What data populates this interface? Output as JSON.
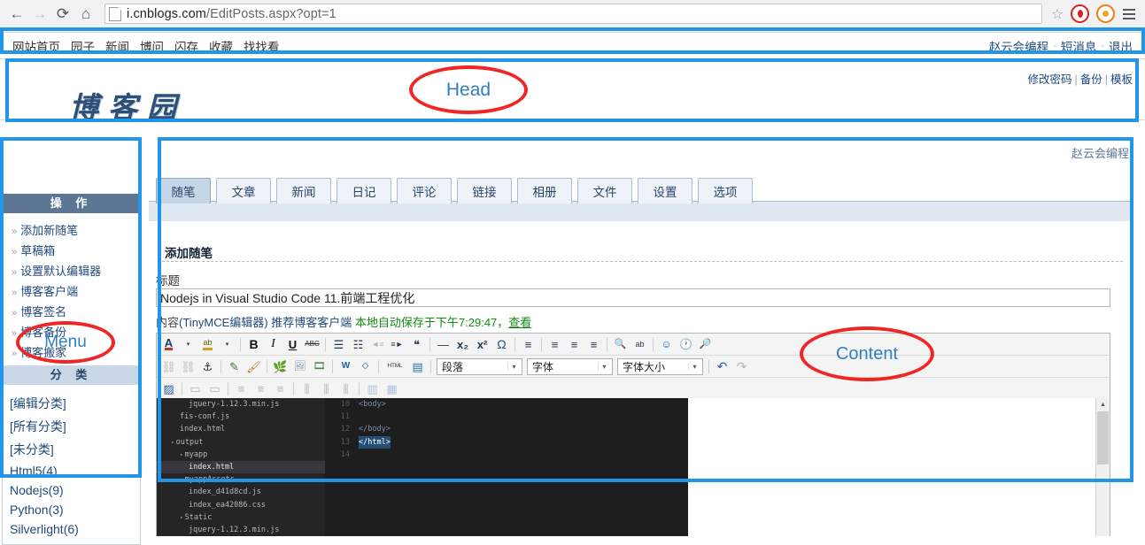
{
  "browser": {
    "back_icon": "←",
    "forward_icon": "→",
    "reload_icon": "⟳",
    "home_icon": "⌂",
    "url_prefix": "i.cnblogs.com",
    "url_path": "/EditPosts.aspx?opt=1",
    "star_icon": "☆",
    "page_icon": "page-icon",
    "extension_1": "opera-icon",
    "extension_2": "orange-circle-icon",
    "menu_icon": "hamburger-menu-icon"
  },
  "topnav": {
    "links": [
      "网站首页",
      "园子",
      "新闻",
      "博问",
      "闪存",
      "收藏",
      "找找看"
    ],
    "user": "赵云会编程",
    "messages": "短消息",
    "logout": "退出",
    "separator": "·"
  },
  "header": {
    "logo": "博客园",
    "links": [
      "修改密码",
      "备份",
      "模板"
    ],
    "divider": "|",
    "username": "赵云会编程"
  },
  "sidebar": {
    "operations_title": "操 作",
    "operations": [
      "添加新随笔",
      "草稿箱",
      "设置默认编辑器",
      "博客客户端",
      "博客签名",
      "博客备份",
      "博客搬家"
    ],
    "arrow": "»",
    "categories_title": "分 类",
    "categories": [
      "[编辑分类]",
      "[所有分类]",
      "[未分类]",
      "Html5(4)",
      "Nodejs(9)",
      "Python(3)",
      "Silverlight(6)"
    ]
  },
  "main": {
    "tabs": [
      {
        "label": "随笔",
        "active": true
      },
      {
        "label": "文章",
        "active": false
      },
      {
        "label": "新闻",
        "active": false
      },
      {
        "label": "日记",
        "active": false
      },
      {
        "label": "评论",
        "active": false
      },
      {
        "label": "链接",
        "active": false
      },
      {
        "label": "相册",
        "active": false
      },
      {
        "label": "文件",
        "active": false
      },
      {
        "label": "设置",
        "active": false
      },
      {
        "label": "选项",
        "active": false
      }
    ],
    "section_title": "添加随笔",
    "title_label": "标题",
    "title_value": "Nodejs in Visual Studio Code 11.前端工程优化",
    "meta": {
      "content_label": "内容",
      "editor_name": "(TinyMCE编辑器)",
      "client_tip": "推荐博客客户端",
      "autosave": "本地自动保存于下午7:29:47，",
      "view_link": "查看"
    }
  },
  "editor_toolbar": {
    "row1": [
      {
        "name": "text-color-icon",
        "glyph": "A"
      },
      {
        "name": "text-color-dropdown-icon",
        "glyph": "▾"
      },
      {
        "name": "background-color-icon",
        "glyph": "ab"
      },
      {
        "name": "background-color-dropdown-icon",
        "glyph": "▾"
      },
      {
        "name": "bold-icon",
        "glyph": "B"
      },
      {
        "name": "italic-icon",
        "glyph": "I"
      },
      {
        "name": "underline-icon",
        "glyph": "U"
      },
      {
        "name": "strikethrough-icon",
        "glyph": "ABC"
      },
      {
        "name": "bullet-list-icon",
        "glyph": "☰"
      },
      {
        "name": "numbered-list-icon",
        "glyph": "☷"
      },
      {
        "name": "outdent-icon",
        "glyph": "◄≡"
      },
      {
        "name": "indent-icon",
        "glyph": "≡►"
      },
      {
        "name": "blockquote-icon",
        "glyph": "❝"
      },
      {
        "name": "horizontal-rule-icon",
        "glyph": "—"
      },
      {
        "name": "subscript-icon",
        "glyph": "x₂"
      },
      {
        "name": "superscript-icon",
        "glyph": "x²"
      },
      {
        "name": "special-char-icon",
        "glyph": "Ω"
      },
      {
        "name": "align-left-icon",
        "glyph": "≡"
      },
      {
        "name": "align-center-icon",
        "glyph": "≡"
      },
      {
        "name": "align-right-icon",
        "glyph": "≡"
      },
      {
        "name": "find-icon",
        "glyph": "🔍"
      },
      {
        "name": "replace-icon",
        "glyph": "ab"
      },
      {
        "name": "emoticon-icon",
        "glyph": "☺"
      },
      {
        "name": "insert-date-icon",
        "glyph": "🕐"
      },
      {
        "name": "preview-icon",
        "glyph": "🔎"
      }
    ],
    "row2": [
      {
        "name": "unlink-icon",
        "glyph": "⛓"
      },
      {
        "name": "link-icon",
        "glyph": "⛓"
      },
      {
        "name": "anchor-icon",
        "glyph": "⚓"
      },
      {
        "name": "cleanup-icon",
        "glyph": "✎"
      },
      {
        "name": "remove-format-icon",
        "glyph": "🖌"
      },
      {
        "name": "insert-media-icon",
        "glyph": "🌿"
      },
      {
        "name": "insert-image-icon",
        "glyph": "🖼"
      },
      {
        "name": "insert-video-icon",
        "glyph": "🎞"
      },
      {
        "name": "paste-word-icon",
        "glyph": "W"
      },
      {
        "name": "source-code-icon",
        "glyph": "◇"
      },
      {
        "name": "html-icon",
        "glyph": "HTML"
      },
      {
        "name": "template-icon",
        "glyph": "▤"
      },
      {
        "name": "undo-icon",
        "glyph": "↶"
      },
      {
        "name": "redo-icon",
        "glyph": "↷"
      }
    ],
    "row3": [
      {
        "name": "edit-table-icon",
        "glyph": "▨"
      },
      {
        "name": "table-row-props-icon",
        "glyph": "▭"
      },
      {
        "name": "table-cell-props-icon",
        "glyph": "▭"
      },
      {
        "name": "insert-row-before-icon",
        "glyph": "≡"
      },
      {
        "name": "insert-row-after-icon",
        "glyph": "≡"
      },
      {
        "name": "delete-row-icon",
        "glyph": "≡"
      },
      {
        "name": "insert-col-before-icon",
        "glyph": "⫼"
      },
      {
        "name": "insert-col-after-icon",
        "glyph": "⫼"
      },
      {
        "name": "delete-col-icon",
        "glyph": "⫼"
      },
      {
        "name": "split-cell-icon",
        "glyph": "▥"
      },
      {
        "name": "merge-cell-icon",
        "glyph": "▦"
      }
    ],
    "dropdowns": {
      "paragraph": "段落",
      "font": "字体",
      "font_size": "字体大小",
      "arrow": "▾"
    }
  },
  "editor_content": {
    "screenshot_type": "vscode-screenshot",
    "explorer_files": [
      {
        "label": "jquery-1.12.3.min.js",
        "indent": 3,
        "caret": "",
        "selected": false
      },
      {
        "label": "fis-conf.js",
        "indent": 2,
        "caret": "",
        "selected": false
      },
      {
        "label": "index.html",
        "indent": 2,
        "caret": "",
        "selected": false
      },
      {
        "label": "output",
        "indent": 1,
        "caret": "▾",
        "selected": false
      },
      {
        "label": "myapp",
        "indent": 2,
        "caret": "▾",
        "selected": false
      },
      {
        "label": "index.html",
        "indent": 3,
        "caret": "",
        "selected": true
      },
      {
        "label": "myappAssets",
        "indent": 2,
        "caret": "▾",
        "selected": false
      },
      {
        "label": "index_d41d8cd.js",
        "indent": 3,
        "caret": "",
        "selected": false
      },
      {
        "label": "index_ea42086.css",
        "indent": 3,
        "caret": "",
        "selected": false
      },
      {
        "label": "Static",
        "indent": 2,
        "caret": "▾",
        "selected": false
      },
      {
        "label": "jquery-1.12.3.min.js",
        "indent": 3,
        "caret": "",
        "selected": false
      }
    ],
    "code_lines": [
      {
        "num": "10",
        "text": "<body>",
        "selected": false
      },
      {
        "num": "11",
        "text": "",
        "selected": false
      },
      {
        "num": "12",
        "text": "</body>",
        "selected": false
      },
      {
        "num": "13",
        "text": "</html>",
        "selected": true
      },
      {
        "num": "14",
        "text": "",
        "selected": false
      }
    ],
    "scroll_up_arrow": "▲"
  },
  "annotations": {
    "head_label": "Head",
    "menu_label": "Menu",
    "content_label": "Content",
    "box_color": "#2196e8",
    "ellipse_color": "#f02626",
    "label_color": "#2f7fc4"
  }
}
